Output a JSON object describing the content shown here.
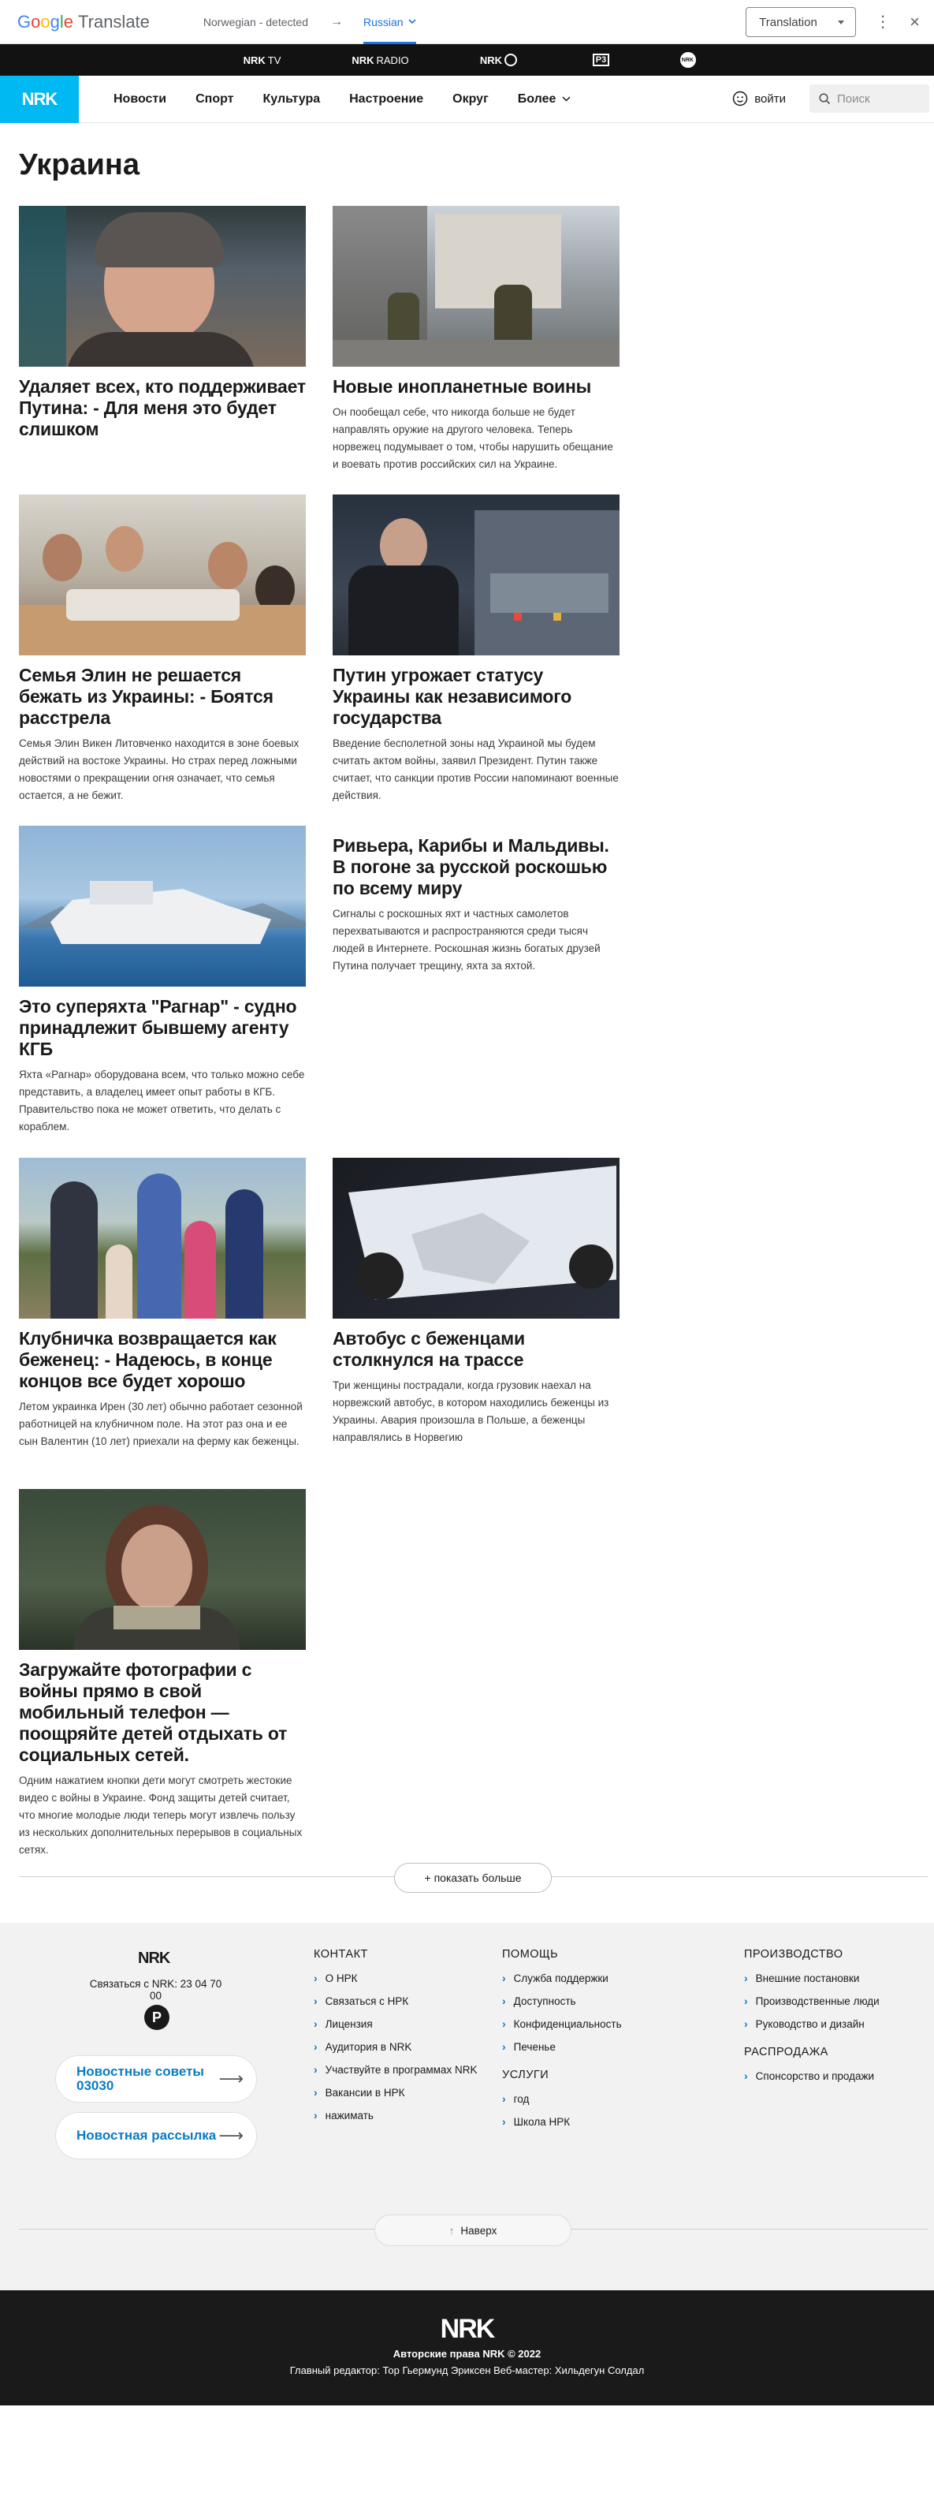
{
  "translate_bar": {
    "logo_google": [
      "G",
      "o",
      "o",
      "g",
      "l",
      "e"
    ],
    "logo_translate": "Translate",
    "source_lang": "Norwegian - detected",
    "arrow": "→",
    "target_lang": "Russian",
    "mode_select": "Translation"
  },
  "nrk_strip": {
    "items": [
      {
        "bold": "NRK",
        "sub": "TV"
      },
      {
        "bold": "NRK",
        "sub": "RADIO"
      },
      {
        "bold": "NRK",
        "sub": ""
      },
      {
        "bold": "P3",
        "sub": ""
      },
      {
        "bold": "NRK",
        "sub": ""
      }
    ]
  },
  "nav": {
    "logo": "NRK",
    "items": [
      "Новости",
      "Спорт",
      "Культура",
      "Настроение",
      "Округ",
      "Более"
    ],
    "login": "войти",
    "search_placeholder": "Поиск"
  },
  "page_title": "Украина",
  "articles": [
    {
      "title": "Удаляет всех, кто поддерживает Путина: - Для меня это будет слишком",
      "text": ""
    },
    {
      "title": "Новые инопланетные воины",
      "text": "Он пообещал себе, что никогда больше не будет направлять оружие на другого человека. Теперь норвежец подумывает о том, чтобы нарушить обещание и воевать против российских сил на Украине."
    },
    {
      "title": "Семья Элин не решается бежать из Украины: - Боятся расстрела",
      "text": "Семья Элин Викен Литовченко находится в зоне боевых действий на востоке Украины. Но страх перед ложными новостями о прекращении огня означает, что семья остается, а не бежит."
    },
    {
      "title": "Путин угрожает статусу Украины как независимого государства",
      "text": "Введение бесполетной зоны над Украиной мы будем считать актом войны, заявил Президент. Путин также считает, что санкции против России напоминают военные действия."
    },
    {
      "title": "Это суперяхта \"Рагнар\" - судно принадлежит бывшему агенту КГБ",
      "text": "Яхта «Рагнар» оборудована всем, что только можно себе представить, а владелец имеет опыт работы в КГБ. Правительство пока не может ответить, что делать с кораблем."
    },
    {
      "title": "Ривьера, Карибы и Мальдивы. В погоне за русской роскошью по всему миру",
      "text": "Сигналы с роскошных яхт и частных самолетов перехватываются и распространяются среди тысяч людей в Интернете. Роскошная жизнь богатых друзей Путина получает трещину, яхта за яхтой."
    },
    {
      "title": "Клубничка возвращается как беженец: - Надеюсь, в конце концов все будет хорошо",
      "text": "Летом украинка Ирен (30 лет) обычно работает сезонной работницей на клубничном поле. На этот раз она и ее сын Валентин (10 лет) приехали на ферму как беженцы."
    },
    {
      "title": "Автобус с беженцами столкнулся на трассе",
      "text": "Три женщины пострадали, когда грузовик наехал на норвежский автобус, в котором находились беженцы из Украины. Авария произошла в Польше, а беженцы направлялись в Норвегию"
    },
    {
      "title": "Загружайте фотографии с войны прямо в свой мобильный телефон — поощряйте детей отдыхать от социальных сетей.",
      "text": "Одним нажатием кнопки дети могут смотреть жестокие видео с войны в Украине. Фонд защиты детей считает, что многие молодые люди теперь могут извлечь пользу из нескольких дополнительных перерывов в социальных сетях."
    }
  ],
  "show_more": "+ показать больше",
  "footer": {
    "logo": "NRK",
    "contact_line": "Связаться с NRK: 23 04 70 00",
    "p_badge": "P",
    "news_tips": "Новостные советы 03030",
    "newsletter": "Новостная рассылка",
    "col1": {
      "heading": "КОНТАКТ",
      "items": [
        "О НРК",
        "Связаться с НРК",
        "Лицензия",
        "Аудитория в NRK",
        "Участвуйте в программах NRK",
        "Вакансии в НРК",
        "нажимать"
      ]
    },
    "col2": {
      "heading": "ПОМОЩЬ",
      "items": [
        "Служба поддержки",
        "Доступность",
        "Конфиденциальность",
        "Печенье"
      ]
    },
    "col2b": {
      "heading": "УСЛУГИ",
      "items": [
        "год",
        "Школа НРК"
      ]
    },
    "col3": {
      "heading": "ПРОИЗВОДСТВО",
      "items": [
        "Внешние постановки",
        "Производственные люди",
        "Руководство и дизайн"
      ]
    },
    "col3b": {
      "heading": "РАСПРОДАЖА",
      "items": [
        "Спонсорство и продажи"
      ]
    },
    "up": "Наверх"
  },
  "bottom": {
    "logo": "NRK",
    "copyright": "Авторские права NRK © 2022",
    "editors": "Главный редактор: Тор Гьермунд Эриксен   Веб-мастер: Хильдегун Солдал"
  }
}
